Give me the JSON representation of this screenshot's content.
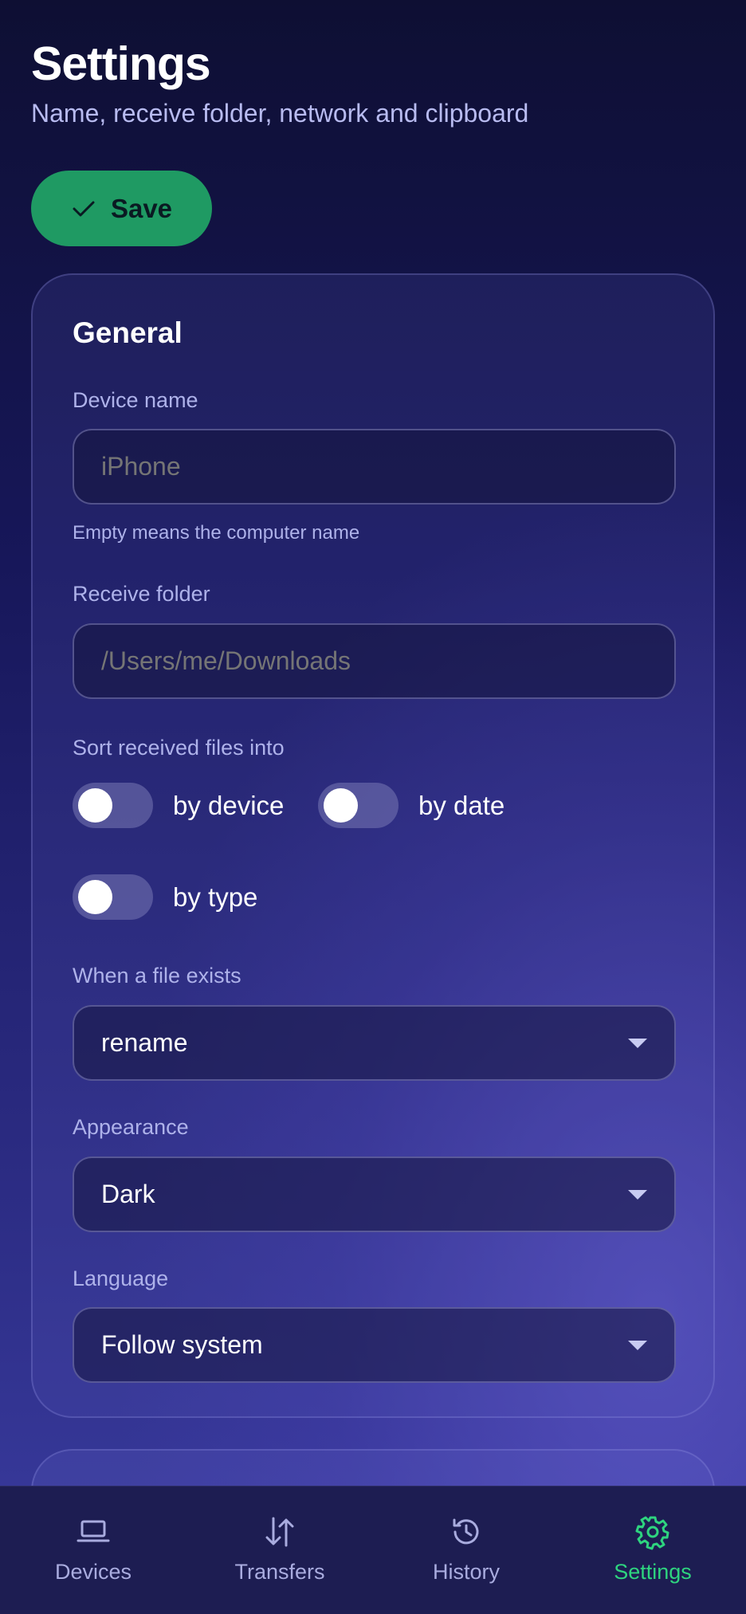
{
  "header": {
    "title": "Settings",
    "subtitle": "Name, receive folder, network and clipboard"
  },
  "save_button": {
    "label": "Save",
    "icon": "check-icon",
    "color": "#1f9a63"
  },
  "general": {
    "title": "General",
    "device_name": {
      "label": "Device name",
      "value": "",
      "placeholder": "iPhone",
      "hint": "Empty means the computer name"
    },
    "receive_folder": {
      "label": "Receive folder",
      "value": "",
      "placeholder": "/Users/me/Downloads"
    },
    "sort": {
      "label": "Sort received files into",
      "options": [
        {
          "label": "by device",
          "checked": false
        },
        {
          "label": "by date",
          "checked": false
        },
        {
          "label": "by type",
          "checked": false
        }
      ]
    },
    "file_exists": {
      "label": "When a file exists",
      "selected": "rename"
    },
    "appearance": {
      "label": "Appearance",
      "selected": "Dark"
    },
    "language": {
      "label": "Language",
      "selected": "Follow system"
    }
  },
  "nav": {
    "active_color": "#2ed47f",
    "items": [
      {
        "label": "Devices",
        "icon": "laptop-icon",
        "active": false
      },
      {
        "label": "Transfers",
        "icon": "arrows-updown-icon",
        "active": false
      },
      {
        "label": "History",
        "icon": "history-icon",
        "active": false
      },
      {
        "label": "Settings",
        "icon": "gear-icon",
        "active": true
      }
    ]
  }
}
